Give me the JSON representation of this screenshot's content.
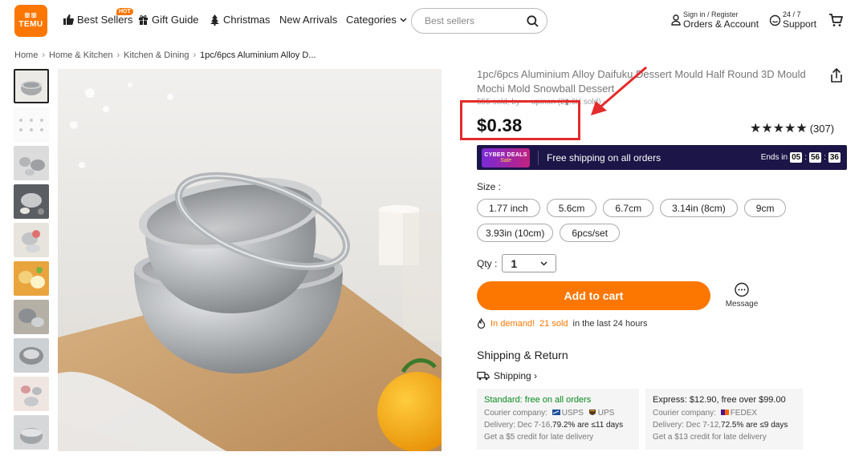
{
  "header": {
    "logo_top": "ꕥꕥ",
    "logo_text": "TEMU",
    "hot_badge": "HOT",
    "nav": {
      "best_sellers": "Best Sellers",
      "gift_guide": "Gift Guide",
      "christmas": "Christmas",
      "new_arrivals": "New Arrivals",
      "categories": "Categories"
    },
    "search": {
      "placeholder": "Best sellers"
    },
    "account": {
      "small": "Sign in / Register",
      "big": "Orders & Account"
    },
    "support": {
      "small": "24 / 7",
      "big": "Support"
    },
    "icons": [
      "thumbs-up-icon",
      "gift-icon",
      "tree-icon",
      "chevron-down-icon",
      "search-icon",
      "user-icon",
      "chat-icon",
      "cart-icon"
    ]
  },
  "breadcrumb": [
    "Home",
    "Home & Kitchen",
    "Kitchen & Dining",
    "1pc/6pcs Aluminium Alloy D..."
  ],
  "product": {
    "title": "1pc/6pcs Aluminium Alloy Daifuku Dessert Mould Half Round 3D Mould Mochi Mold Snowball Dessert",
    "sold_line": "555 sold, by ⚭ upinon (2▮.6K sold) ›",
    "price": "$0.38",
    "rating_stars": "★★★★★",
    "rating_value": 4.5,
    "rating_count": "(307)",
    "deal": {
      "logo_line1": "CYBER DEALS",
      "logo_line2": "Sale",
      "text": "Free shipping on all orders",
      "ends_label": "Ends in",
      "hours": "05",
      "minutes": "56",
      "seconds": "36"
    },
    "size_label": "Size :",
    "sizes_row1": [
      "1.77 inch",
      "5.6cm",
      "6.7cm",
      "3.14in (8cm)",
      "9cm"
    ],
    "sizes_row2": [
      "3.93in (10cm)",
      "6pcs/set"
    ],
    "qty_label": "Qty :",
    "qty_value": "1",
    "add_to_cart": "Add to cart",
    "message": "Message",
    "demand_prefix": "In demand!",
    "demand_sold": "21 sold",
    "demand_suffix": "in the last 24 hours"
  },
  "shipping": {
    "title": "Shipping & Return",
    "link": "Shipping ›",
    "standard": {
      "head": "Standard: free on all orders",
      "courier_label": "Courier company:",
      "carriers": [
        "USPS",
        "UPS"
      ],
      "delivery_label": "Delivery: Dec 7-16,",
      "delivery_stat": "79.2% are ≤11 days",
      "credit": "Get a $5 credit for late delivery"
    },
    "express": {
      "head": "Express: $12.90, free over $99.00",
      "courier_label": "Courier company:",
      "carriers": [
        "FEDEX"
      ],
      "delivery_label": "Delivery: Dec 7-12,",
      "delivery_stat": "72.5% are ≤9 days",
      "credit": "Get a $13 credit for late delivery"
    }
  },
  "colors": {
    "brand_orange": "#fb7701",
    "deal_bar": "#1c1548",
    "highlight_red": "#e52b2b",
    "green": "#0a8a1f"
  }
}
